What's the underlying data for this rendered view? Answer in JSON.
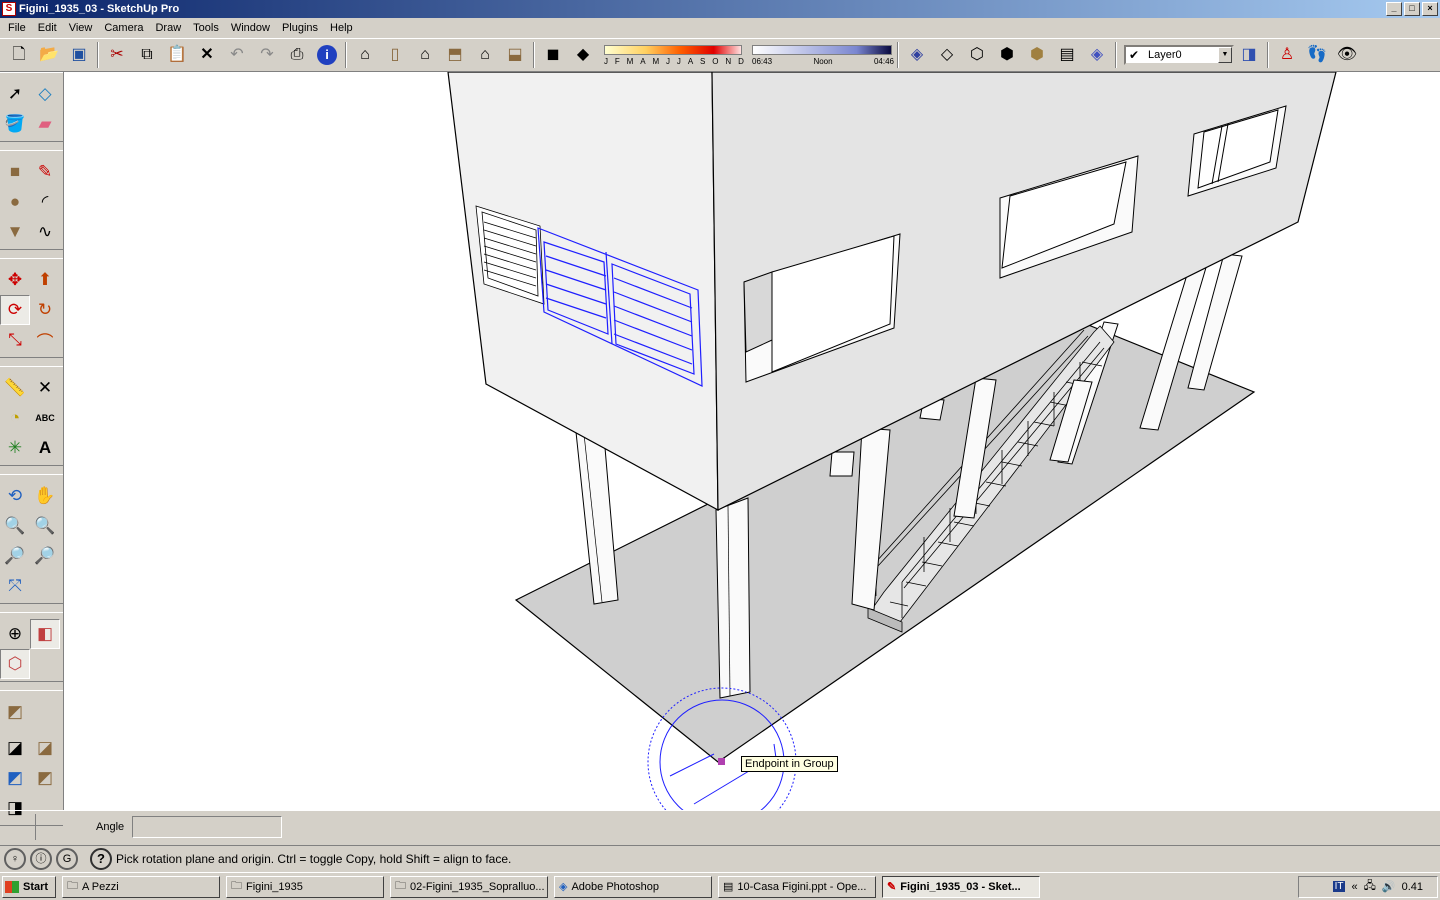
{
  "window": {
    "title": "Figini_1935_03 - SketchUp Pro",
    "icon": "sketchup-icon"
  },
  "menu": [
    "File",
    "Edit",
    "View",
    "Camera",
    "Draw",
    "Tools",
    "Window",
    "Plugins",
    "Help"
  ],
  "toolbar": {
    "shadow_months": [
      "J",
      "F",
      "M",
      "A",
      "M",
      "J",
      "J",
      "A",
      "S",
      "O",
      "N",
      "D"
    ],
    "time_labels": [
      "06:43",
      "Noon",
      "04:46"
    ],
    "layer": {
      "name": "Layer0",
      "checked": true
    }
  },
  "viewport": {
    "tooltip": "Endpoint in Group",
    "inference_color": "#b040b0",
    "protractor_color": "#1f1fff"
  },
  "measurements": {
    "label": "Angle",
    "value": ""
  },
  "status": {
    "text": "Pick rotation plane and origin.  Ctrl = toggle Copy, hold Shift = align to face."
  },
  "taskbar": {
    "start": "Start",
    "tasks": [
      {
        "label": "A Pezzi",
        "icon": "folder-icon",
        "active": false
      },
      {
        "label": "Figini_1935",
        "icon": "folder-icon",
        "active": false
      },
      {
        "label": "02-Figini_1935_Sopralluo...",
        "icon": "folder-icon",
        "active": false
      },
      {
        "label": "Adobe Photoshop",
        "icon": "photoshop-icon",
        "active": false
      },
      {
        "label": "10-Casa Figini.ppt - Ope...",
        "icon": "presentation-icon",
        "active": false
      },
      {
        "label": "Figini_1935_03 - Sket...",
        "icon": "sketchup-icon",
        "active": true
      }
    ],
    "tray": {
      "lang": "IT",
      "clock": "0.41"
    }
  }
}
